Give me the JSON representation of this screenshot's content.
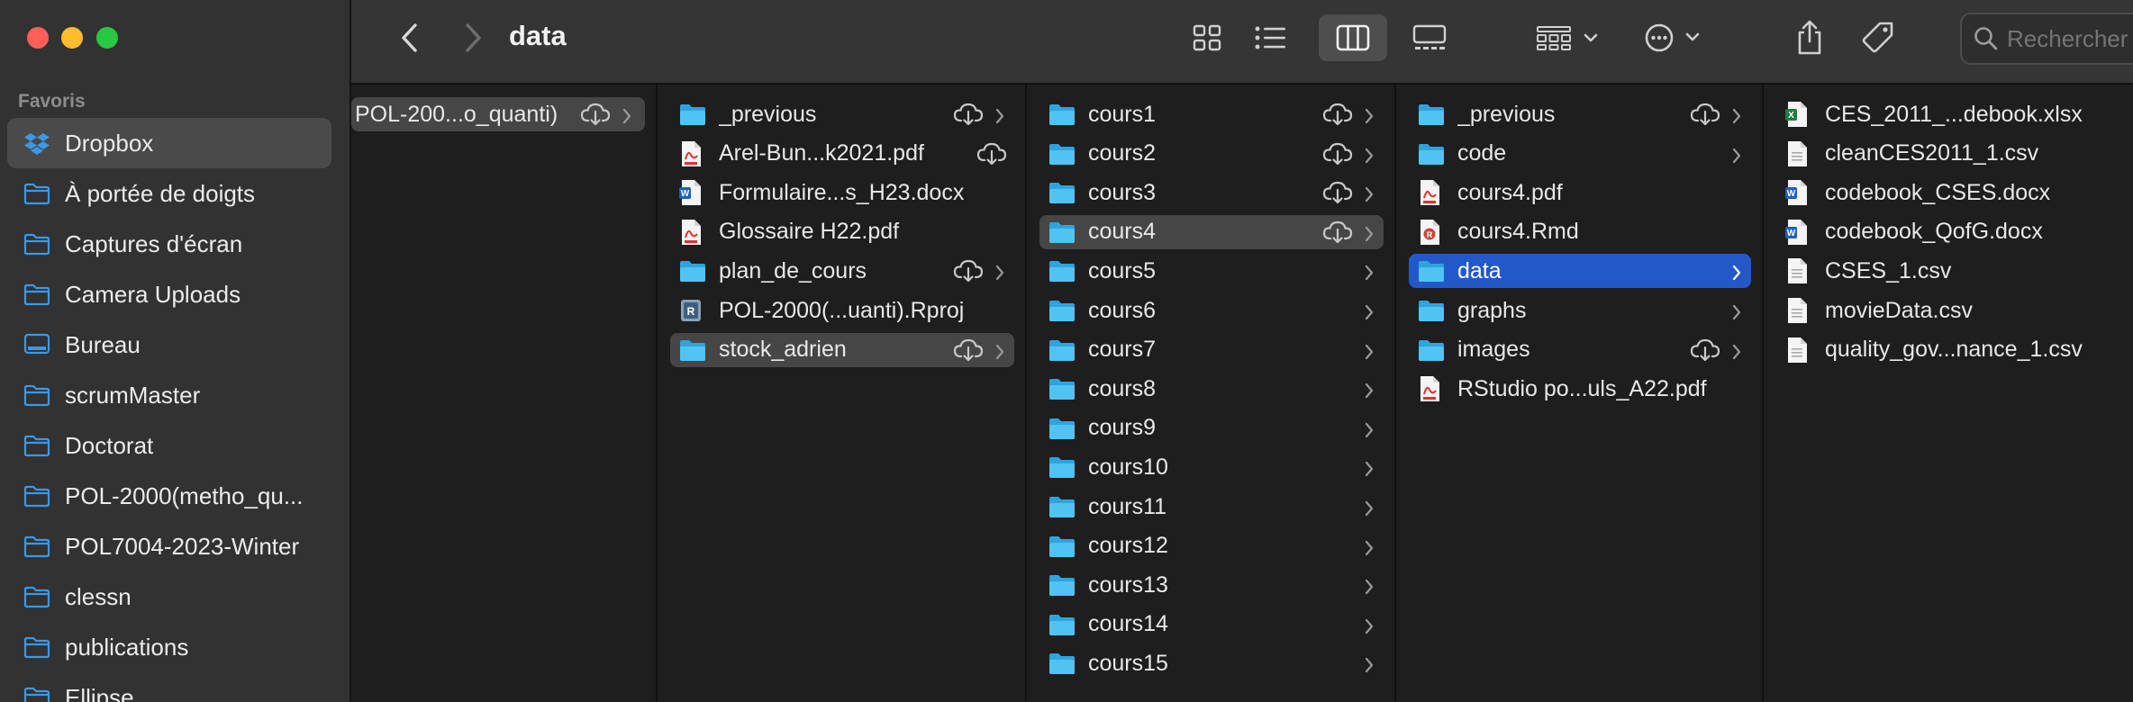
{
  "window": {
    "title": "data"
  },
  "sidebar": {
    "heading": "Favoris",
    "items": [
      {
        "label": "Dropbox",
        "icon": "dropbox-icon",
        "selected": true
      },
      {
        "label": "À portée de doigts",
        "icon": "folder-icon"
      },
      {
        "label": "Captures d'écran",
        "icon": "folder-icon"
      },
      {
        "label": "Camera Uploads",
        "icon": "folder-icon"
      },
      {
        "label": "Bureau",
        "icon": "desktop-icon"
      },
      {
        "label": "scrumMaster",
        "icon": "folder-icon"
      },
      {
        "label": "Doctorat",
        "icon": "folder-icon"
      },
      {
        "label": "POL-2000(metho_qu...",
        "icon": "folder-icon"
      },
      {
        "label": "POL7004-2023-Winter",
        "icon": "folder-icon"
      },
      {
        "label": "clessn",
        "icon": "folder-icon"
      },
      {
        "label": "publications",
        "icon": "folder-icon"
      },
      {
        "label": "Ellipse",
        "icon": "folder-icon"
      }
    ]
  },
  "toolbar": {
    "back": "chevron-left-icon",
    "forward": "chevron-right-icon",
    "views": [
      "icon-view",
      "list-view",
      "column-view",
      "gallery-view"
    ],
    "active_view": "column-view",
    "search_placeholder": "Rechercher"
  },
  "columns": [
    {
      "items": [
        {
          "name": "POL-200...o_quanti)",
          "type": "folder-plain",
          "cloud": true,
          "chevron": true,
          "selected": "grey"
        }
      ]
    },
    {
      "items": [
        {
          "name": "_previous",
          "type": "folder",
          "cloud": true,
          "chevron": true
        },
        {
          "name": "Arel-Bun...k2021.pdf",
          "type": "pdf",
          "cloud": true
        },
        {
          "name": "Formulaire...s_H23.docx",
          "type": "docx"
        },
        {
          "name": "Glossaire H22.pdf",
          "type": "pdf"
        },
        {
          "name": "plan_de_cours",
          "type": "folder",
          "cloud": true,
          "chevron": true
        },
        {
          "name": "POL-2000(...uanti).Rproj",
          "type": "rproj"
        },
        {
          "name": "stock_adrien",
          "type": "folder",
          "cloud": true,
          "chevron": true,
          "selected": "grey"
        }
      ]
    },
    {
      "items": [
        {
          "name": "cours1",
          "type": "folder",
          "cloud": true,
          "chevron": true
        },
        {
          "name": "cours2",
          "type": "folder",
          "cloud": true,
          "chevron": true
        },
        {
          "name": "cours3",
          "type": "folder",
          "cloud": true,
          "chevron": true
        },
        {
          "name": "cours4",
          "type": "folder",
          "cloud": true,
          "chevron": true,
          "selected": "grey"
        },
        {
          "name": "cours5",
          "type": "folder",
          "chevron": true
        },
        {
          "name": "cours6",
          "type": "folder",
          "chevron": true
        },
        {
          "name": "cours7",
          "type": "folder",
          "chevron": true
        },
        {
          "name": "cours8",
          "type": "folder",
          "chevron": true
        },
        {
          "name": "cours9",
          "type": "folder",
          "chevron": true
        },
        {
          "name": "cours10",
          "type": "folder",
          "chevron": true
        },
        {
          "name": "cours11",
          "type": "folder",
          "chevron": true
        },
        {
          "name": "cours12",
          "type": "folder",
          "chevron": true
        },
        {
          "name": "cours13",
          "type": "folder",
          "chevron": true
        },
        {
          "name": "cours14",
          "type": "folder",
          "chevron": true
        },
        {
          "name": "cours15",
          "type": "folder",
          "chevron": true
        }
      ]
    },
    {
      "items": [
        {
          "name": "_previous",
          "type": "folder",
          "cloud": true,
          "chevron": true
        },
        {
          "name": "code",
          "type": "folder",
          "chevron": true
        },
        {
          "name": "cours4.pdf",
          "type": "pdf"
        },
        {
          "name": "cours4.Rmd",
          "type": "rmd"
        },
        {
          "name": "data",
          "type": "folder",
          "chevron": true,
          "selected": "blue"
        },
        {
          "name": "graphs",
          "type": "folder",
          "chevron": true
        },
        {
          "name": "images",
          "type": "folder",
          "cloud": true,
          "chevron": true
        },
        {
          "name": "RStudio po...uls_A22.pdf",
          "type": "pdf"
        }
      ]
    },
    {
      "items": [
        {
          "name": "CES_2011_...debook.xlsx",
          "type": "xlsx"
        },
        {
          "name": "cleanCES2011_1.csv",
          "type": "csv"
        },
        {
          "name": "codebook_CSES.docx",
          "type": "docx"
        },
        {
          "name": "codebook_QofG.docx",
          "type": "docx"
        },
        {
          "name": "CSES_1.csv",
          "type": "csv"
        },
        {
          "name": "movieData.csv",
          "type": "csv"
        },
        {
          "name": "quality_gov...nance_1.csv",
          "type": "csv"
        }
      ]
    }
  ]
}
